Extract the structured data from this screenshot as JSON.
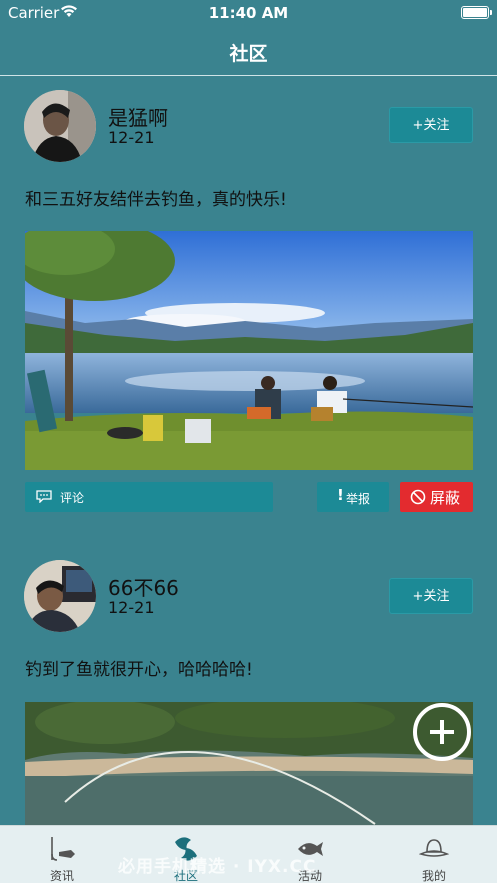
{
  "status_bar": {
    "carrier": "Carrier",
    "time": "11:40 AM"
  },
  "nav": {
    "title": "社区"
  },
  "posts": [
    {
      "username": "是猛啊",
      "date": "12-21",
      "follow_label": "+关注",
      "text": "和三五好友结伴去钓鱼，真的快乐!",
      "comment_label": "评论",
      "report_label": "举报",
      "block_label": "屏蔽"
    },
    {
      "username": "66不66",
      "date": "12-21",
      "follow_label": "+关注",
      "text": "钓到了鱼就很开心，哈哈哈哈!"
    }
  ],
  "tabs": [
    {
      "label": "资讯",
      "icon": "fishing-rod-icon"
    },
    {
      "label": "社区",
      "icon": "fish-pair-icon",
      "active": true
    },
    {
      "label": "活动",
      "icon": "fish-icon"
    },
    {
      "label": "我的",
      "icon": "fishing-hat-icon"
    }
  ],
  "watermark": "必用手机精选 · IYX.CC",
  "colors": {
    "background": "#3a838f",
    "accent": "#1c8a96",
    "danger": "#e32b2f"
  }
}
